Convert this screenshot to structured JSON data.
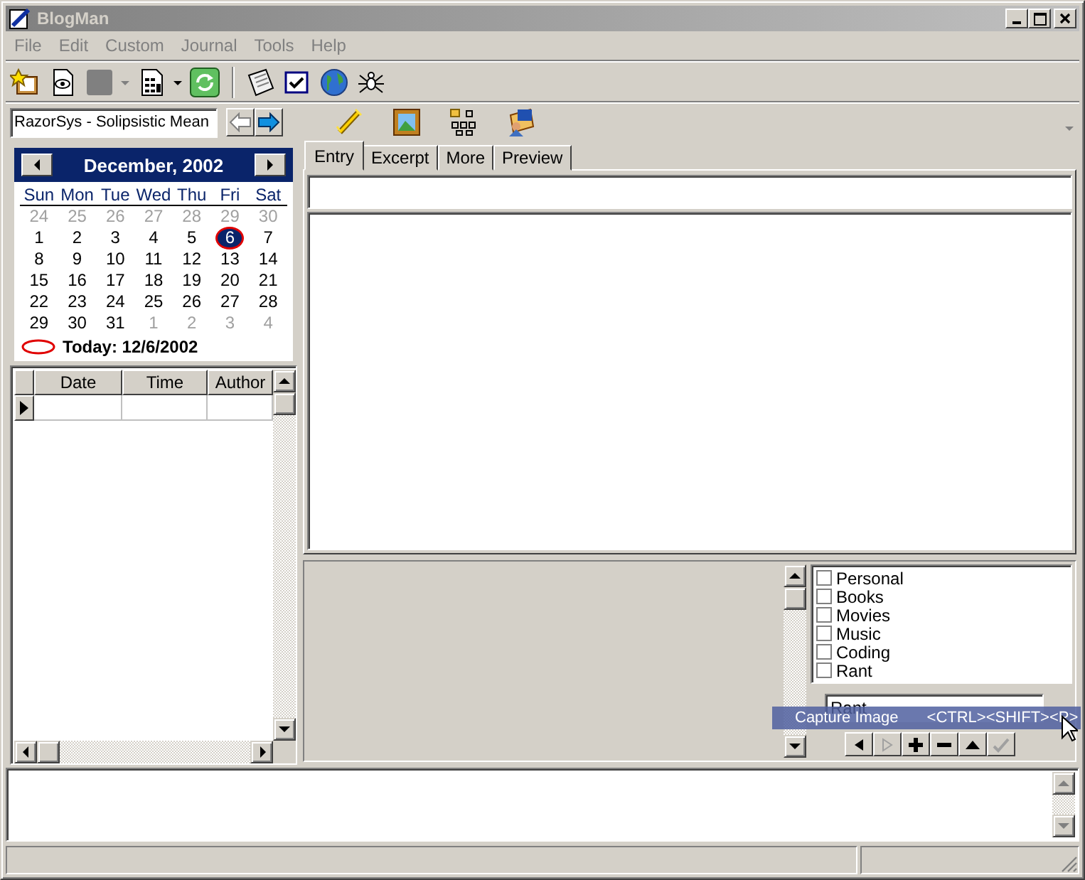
{
  "window": {
    "title": "BlogMan"
  },
  "menu": [
    "File",
    "Edit",
    "Custom",
    "Journal",
    "Tools",
    "Help"
  ],
  "blog_selector": {
    "value": "RazorSys - Solipsistic Mean"
  },
  "nav_buttons": [
    {
      "kind": "back",
      "disabled": true
    },
    {
      "kind": "forward",
      "disabled": false
    }
  ],
  "calendar": {
    "month": "December, 2002",
    "weekdays": [
      "Sun",
      "Mon",
      "Tue",
      "Wed",
      "Thu",
      "Fri",
      "Sat"
    ],
    "weeks": [
      [
        {
          "day": "24",
          "outside": true,
          "selected": false
        },
        {
          "day": "25",
          "outside": true,
          "selected": false
        },
        {
          "day": "26",
          "outside": true,
          "selected": false
        },
        {
          "day": "27",
          "outside": true,
          "selected": false
        },
        {
          "day": "28",
          "outside": true,
          "selected": false
        },
        {
          "day": "29",
          "outside": true,
          "selected": false
        },
        {
          "day": "30",
          "outside": true,
          "selected": false
        }
      ],
      [
        {
          "day": "1",
          "outside": false,
          "selected": false
        },
        {
          "day": "2",
          "outside": false,
          "selected": false
        },
        {
          "day": "3",
          "outside": false,
          "selected": false
        },
        {
          "day": "4",
          "outside": false,
          "selected": false
        },
        {
          "day": "5",
          "outside": false,
          "selected": false
        },
        {
          "day": "6",
          "outside": false,
          "selected": true
        },
        {
          "day": "7",
          "outside": false,
          "selected": false
        }
      ],
      [
        {
          "day": "8",
          "outside": false,
          "selected": false
        },
        {
          "day": "9",
          "outside": false,
          "selected": false
        },
        {
          "day": "10",
          "outside": false,
          "selected": false
        },
        {
          "day": "11",
          "outside": false,
          "selected": false
        },
        {
          "day": "12",
          "outside": false,
          "selected": false
        },
        {
          "day": "13",
          "outside": false,
          "selected": false
        },
        {
          "day": "14",
          "outside": false,
          "selected": false
        }
      ],
      [
        {
          "day": "15",
          "outside": false,
          "selected": false
        },
        {
          "day": "16",
          "outside": false,
          "selected": false
        },
        {
          "day": "17",
          "outside": false,
          "selected": false
        },
        {
          "day": "18",
          "outside": false,
          "selected": false
        },
        {
          "day": "19",
          "outside": false,
          "selected": false
        },
        {
          "day": "20",
          "outside": false,
          "selected": false
        },
        {
          "day": "21",
          "outside": false,
          "selected": false
        }
      ],
      [
        {
          "day": "22",
          "outside": false,
          "selected": false
        },
        {
          "day": "23",
          "outside": false,
          "selected": false
        },
        {
          "day": "24",
          "outside": false,
          "selected": false
        },
        {
          "day": "25",
          "outside": false,
          "selected": false
        },
        {
          "day": "26",
          "outside": false,
          "selected": false
        },
        {
          "day": "27",
          "outside": false,
          "selected": false
        },
        {
          "day": "28",
          "outside": false,
          "selected": false
        }
      ],
      [
        {
          "day": "29",
          "outside": false,
          "selected": false
        },
        {
          "day": "30",
          "outside": false,
          "selected": false
        },
        {
          "day": "31",
          "outside": false,
          "selected": false
        },
        {
          "day": "1",
          "outside": true,
          "selected": false
        },
        {
          "day": "2",
          "outside": true,
          "selected": false
        },
        {
          "day": "3",
          "outside": true,
          "selected": false
        },
        {
          "day": "4",
          "outside": true,
          "selected": false
        }
      ]
    ],
    "today": "Today: 12/6/2002"
  },
  "entries_table": {
    "columns": [
      "Date",
      "Time",
      "Author"
    ]
  },
  "tabs": [
    {
      "label": "Entry",
      "selected": true
    },
    {
      "label": "Excerpt",
      "selected": false
    },
    {
      "label": "More",
      "selected": false
    },
    {
      "label": "Preview",
      "selected": false
    }
  ],
  "categories": [
    {
      "label": "Personal",
      "checked": false
    },
    {
      "label": "Books",
      "checked": false
    },
    {
      "label": "Movies",
      "checked": false
    },
    {
      "label": "Music",
      "checked": false
    },
    {
      "label": "Coding",
      "checked": false
    },
    {
      "label": "Rant",
      "checked": false
    }
  ],
  "category_field": {
    "value": "Rant"
  },
  "tooltip": {
    "text": "Capture Image",
    "shortcut": "<CTRL><SHIFT><P>"
  },
  "category_buttons": [
    {
      "kind": "left",
      "disabled": false
    },
    {
      "kind": "right",
      "disabled": true
    },
    {
      "kind": "add",
      "disabled": false
    },
    {
      "kind": "remove",
      "disabled": false
    },
    {
      "kind": "up",
      "disabled": false
    },
    {
      "kind": "check",
      "disabled": true
    }
  ]
}
